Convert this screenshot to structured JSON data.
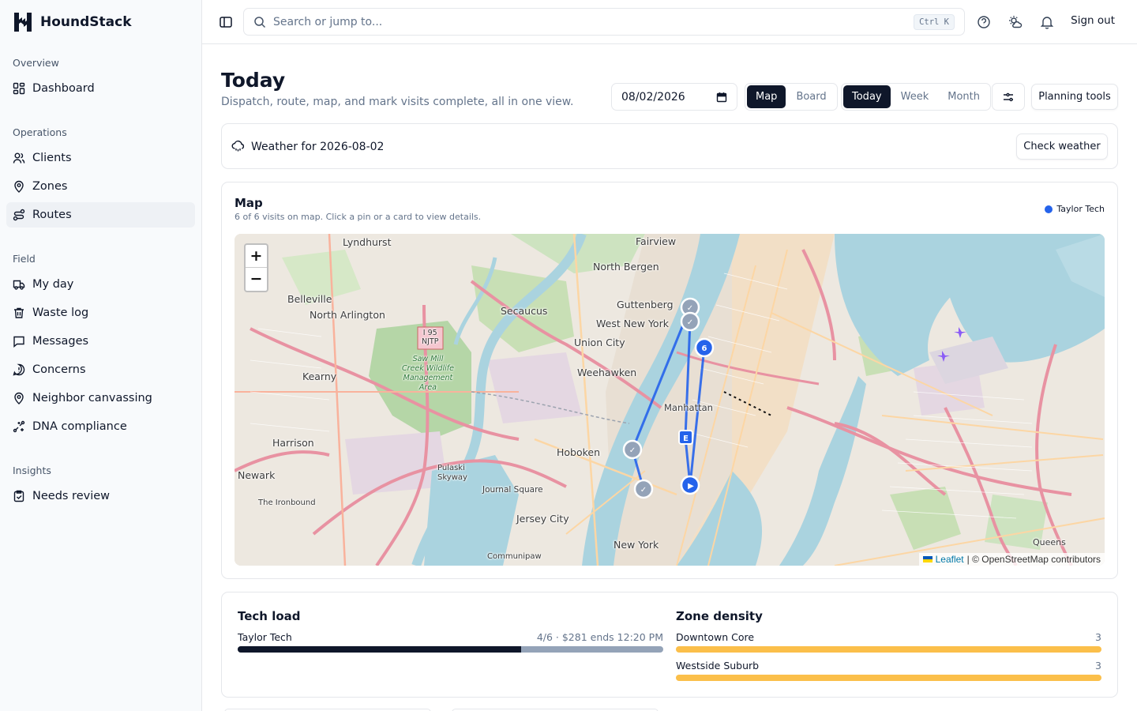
{
  "brand": {
    "name": "HoundStack"
  },
  "sidebar": {
    "sections": [
      {
        "heading": "Overview",
        "items": [
          {
            "label": "Dashboard",
            "icon": "dashboard-icon"
          }
        ]
      },
      {
        "heading": "Operations",
        "items": [
          {
            "label": "Clients",
            "icon": "users-icon"
          },
          {
            "label": "Zones",
            "icon": "map-pin-icon"
          },
          {
            "label": "Routes",
            "icon": "route-icon",
            "active": true
          }
        ]
      },
      {
        "heading": "Field",
        "items": [
          {
            "label": "My day",
            "icon": "truck-icon"
          },
          {
            "label": "Waste log",
            "icon": "trash-icon"
          },
          {
            "label": "Messages",
            "icon": "message-icon"
          },
          {
            "label": "Concerns",
            "icon": "alert-icon"
          },
          {
            "label": "Neighbor canvassing",
            "icon": "map-pin-icon"
          },
          {
            "label": "DNA compliance",
            "icon": "sparkle-icon"
          }
        ]
      },
      {
        "heading": "Insights",
        "items": [
          {
            "label": "Needs review",
            "icon": "clipboard-check-icon"
          }
        ]
      }
    ]
  },
  "topbar": {
    "search_placeholder": "Search or jump to...",
    "shortcut": "Ctrl K",
    "signout_label": "Sign out",
    "icons": [
      "help-icon",
      "weather-icon",
      "bell-icon"
    ]
  },
  "header": {
    "title": "Today",
    "subtitle": "Dispatch, route, map, and mark visits complete, all in one view.",
    "date_value": "08/02/2026",
    "view_toggle": {
      "options": [
        "Map",
        "Board"
      ],
      "selected": "Map"
    },
    "range_toggle": {
      "options": [
        "Today",
        "Week",
        "Month"
      ],
      "selected": "Today"
    },
    "planning_label": "Planning tools"
  },
  "weather": {
    "label": "Weather for 2026-08-02",
    "button": "Check weather"
  },
  "map_card": {
    "title": "Map",
    "subtitle": "6 of 6 visits on map. Click a pin or a card to view details.",
    "legend": [
      {
        "name": "Taylor Tech",
        "color": "#2563eb"
      }
    ],
    "zoom_in": "+",
    "zoom_out": "−",
    "attribution_link": "Leaflet",
    "attribution_text": "| © OpenStreetMap contributors",
    "place_labels": {
      "lyndhurst": "Lyndhurst",
      "fairview": "Fairview",
      "north_bergen": "North Bergen",
      "belleville": "Belleville",
      "north_arlington": "North Arlington",
      "secaucus": "Secaucus",
      "guttenberg": "Guttenberg",
      "west_new_york": "West New York",
      "union_city": "Union City",
      "weehawken": "Weehawken",
      "kearny": "Kearny",
      "manhattan": "Manhattan",
      "harrison": "Harrison",
      "hoboken": "Hoboken",
      "newark": "Newark",
      "pulaski": "Pulaski\nSkyway",
      "journal_square": "Journal Square",
      "jersey_city": "Jersey City",
      "new_york": "New York",
      "queens": "Queens",
      "ironbound": "The Ironbound",
      "communipaw": "Communipaw",
      "i95": "I 95\nNJTP",
      "sawmill": "Saw Mill\nCreek Wildlife\nManagement\nArea"
    },
    "markers": {
      "cluster_count": "6",
      "end_marker": "E",
      "start_marker": "▶",
      "done_marker": "✓"
    }
  },
  "tech_load": {
    "title": "Tech load",
    "rows": [
      {
        "name": "Taylor Tech",
        "summary": "4/6 · $281  ends 12:20 PM",
        "completed": 4,
        "total": 6
      }
    ]
  },
  "zone_density": {
    "title": "Zone density",
    "rows": [
      {
        "name": "Downtown Core",
        "count": "3"
      },
      {
        "name": "Westside Suburb",
        "count": "3"
      }
    ]
  },
  "colors": {
    "accent": "#0f172a",
    "route": "#2563eb",
    "zone_bar": "#fbbf4a",
    "tech_bar_bg": "#94a3b8"
  }
}
